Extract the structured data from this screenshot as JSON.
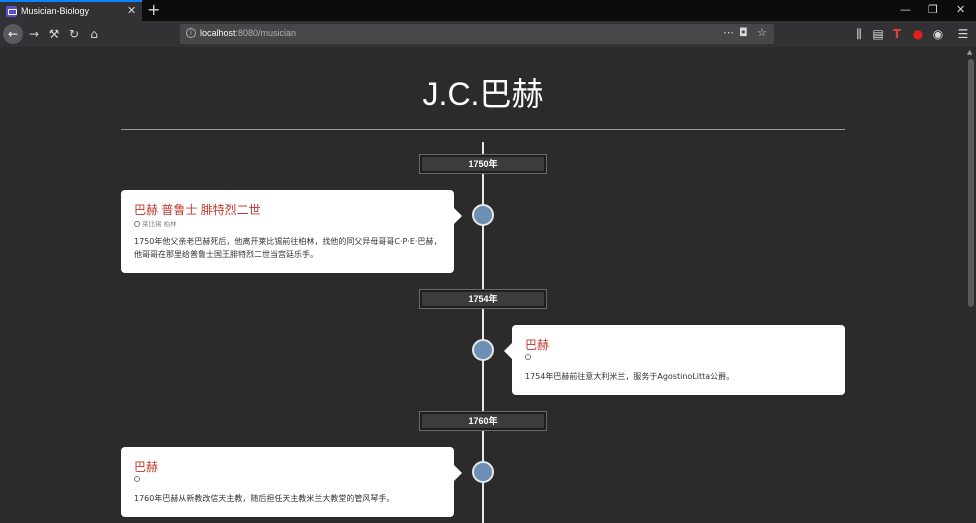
{
  "browser": {
    "tab_title": "Musician-Biology",
    "url_host": "localhost",
    "url_rest": ":8080/musician"
  },
  "page": {
    "title": "J.C.巴赫",
    "years": [
      "1750年",
      "1754年",
      "1760年"
    ],
    "events": [
      {
        "title": "巴赫 普鲁士 腓特烈二世",
        "meta": "莱比锡 柏林",
        "text": "1750年他父亲老巴赫死后，他离开莱比锡前往柏林，找他的同父异母哥哥C·P·E·巴赫，他哥哥在那里给普鲁士国王腓特烈二世当宫廷乐手。"
      },
      {
        "title": "巴赫",
        "meta": "",
        "text": "1754年巴赫前往意大利米兰，服务于AgostinoLitta公爵。"
      },
      {
        "title": "巴赫",
        "meta": "",
        "text": "1760年巴赫从新教改信天主教，随后担任天主教米兰大教堂的管风琴手。"
      }
    ]
  },
  "colors": {
    "accent_title": "#c0392b",
    "dot": "#6e8fb5",
    "background": "#2b2b2b"
  }
}
